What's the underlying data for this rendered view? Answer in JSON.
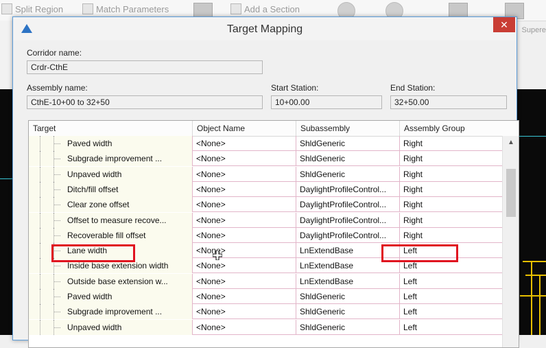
{
  "ribbon": {
    "split_region": "Split Region",
    "match_parameters": "Match Parameters",
    "add_section": "Add a Section",
    "far_label": "Supere"
  },
  "dialog": {
    "title": "Target Mapping",
    "close_symbol": "✕",
    "corridor_name_label": "Corridor name:",
    "corridor_name_value": "Crdr-CthE",
    "assembly_name_label": "Assembly name:",
    "assembly_name_value": "CthE-10+00 to 32+50",
    "start_station_label": "Start Station:",
    "start_station_value": "10+00.00",
    "end_station_label": "End Station:",
    "end_station_value": "32+50.00"
  },
  "table": {
    "headers": [
      "Target",
      "Object Name",
      "Subassembly",
      "Assembly Group"
    ],
    "rows": [
      {
        "target": "Paved width",
        "object": "<None>",
        "sub": "ShldGeneric",
        "group": "Right"
      },
      {
        "target": "Subgrade improvement ...",
        "object": "<None>",
        "sub": "ShldGeneric",
        "group": "Right"
      },
      {
        "target": "Unpaved width",
        "object": "<None>",
        "sub": "ShldGeneric",
        "group": "Right"
      },
      {
        "target": "Ditch/fill offset",
        "object": "<None>",
        "sub": "DaylightProfileControl...",
        "group": "Right"
      },
      {
        "target": "Clear zone offset",
        "object": "<None>",
        "sub": "DaylightProfileControl...",
        "group": "Right"
      },
      {
        "target": "Offset to measure recove...",
        "object": "<None>",
        "sub": "DaylightProfileControl...",
        "group": "Right"
      },
      {
        "target": "Recoverable fill offset",
        "object": "<None>",
        "sub": "DaylightProfileControl...",
        "group": "Right"
      },
      {
        "target": "Lane width",
        "object": "<None>",
        "sub": "LnExtendBase",
        "group": "Left"
      },
      {
        "target": "Inside base extension width",
        "object": "<None>",
        "sub": "LnExtendBase",
        "group": "Left"
      },
      {
        "target": "Outside base extension w...",
        "object": "<None>",
        "sub": "LnExtendBase",
        "group": "Left"
      },
      {
        "target": "Paved width",
        "object": "<None>",
        "sub": "ShldGeneric",
        "group": "Left"
      },
      {
        "target": "Subgrade improvement ...",
        "object": "<None>",
        "sub": "ShldGeneric",
        "group": "Left"
      },
      {
        "target": "Unpaved width",
        "object": "<None>",
        "sub": "ShldGeneric",
        "group": "Left"
      }
    ]
  },
  "colors": {
    "highlight": "#e0121f",
    "close_button": "#c93d34",
    "cell_border": "#e2b5c9"
  }
}
